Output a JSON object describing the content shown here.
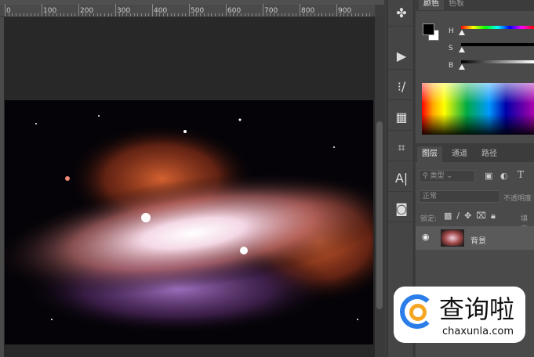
{
  "ruler": {
    "ticks": [
      "0",
      "100",
      "200",
      "300",
      "400",
      "500",
      "600",
      "700",
      "800",
      "900"
    ]
  },
  "tools": [
    {
      "icon": "puzzle-icon",
      "glyph": "✤"
    },
    {
      "icon": "play-icon",
      "glyph": "▶"
    },
    {
      "icon": "brush-preset-icon",
      "glyph": "⁝/"
    },
    {
      "icon": "tool-preset-icon",
      "glyph": "▦"
    },
    {
      "icon": "crop-icon",
      "glyph": "⌗"
    },
    {
      "icon": "character-icon",
      "glyph": "A|"
    },
    {
      "icon": "layer-comp-icon",
      "glyph": "◙"
    }
  ],
  "color_panel": {
    "tabs": [
      "颜色",
      "色板"
    ],
    "h": "H",
    "s": "S",
    "b": "B",
    "foreground": "#000000",
    "background": "#ffffff"
  },
  "layers_panel": {
    "tabs": [
      "图层",
      "通道",
      "路径"
    ],
    "filter": "类型",
    "blend_mode": "正常",
    "opacity_label": "不透明度",
    "lock_label": "锁定:",
    "fill_label": "填充",
    "layer_name": "背景"
  },
  "watermark": {
    "brand": "查询啦",
    "domain": "chaxunla.com"
  }
}
